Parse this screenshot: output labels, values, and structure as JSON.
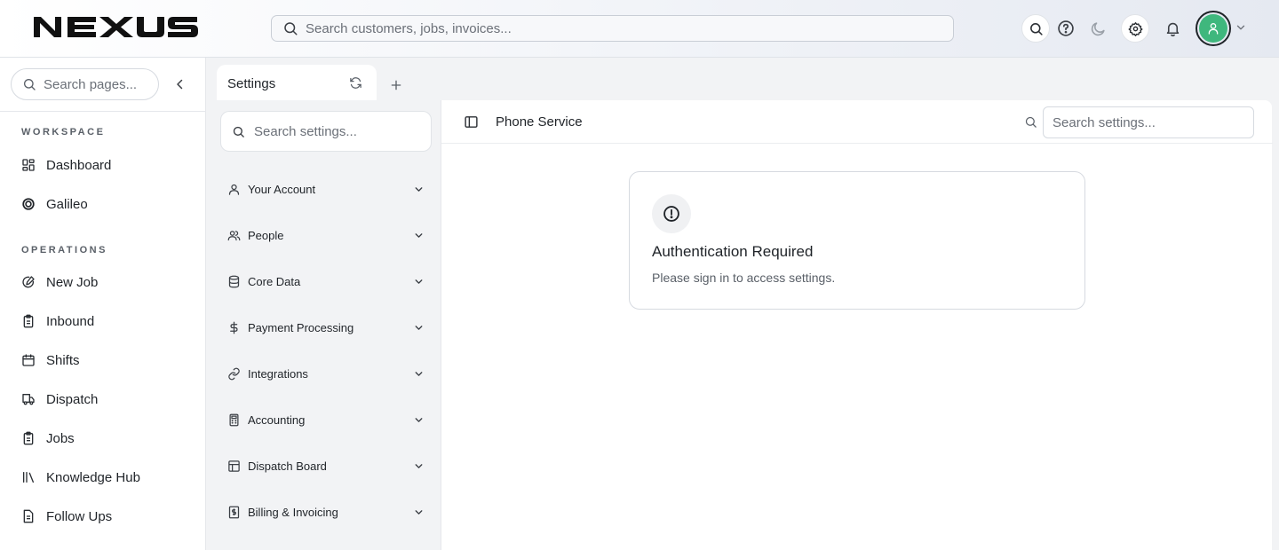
{
  "header": {
    "logo_text": "NEXUS",
    "search_placeholder": "Search customers, jobs, invoices..."
  },
  "sidebar": {
    "search_placeholder": "Search pages...",
    "sections": [
      {
        "label": "WORKSPACE",
        "items": [
          {
            "label": "Dashboard",
            "icon": "dashboard-icon"
          },
          {
            "label": "Galileo",
            "icon": "galileo-icon"
          }
        ]
      },
      {
        "label": "OPERATIONS",
        "items": [
          {
            "label": "New Job",
            "icon": "new-job-icon"
          },
          {
            "label": "Inbound",
            "icon": "clipboard-icon"
          },
          {
            "label": "Shifts",
            "icon": "calendar-icon"
          },
          {
            "label": "Dispatch",
            "icon": "truck-icon"
          },
          {
            "label": "Jobs",
            "icon": "clipboard-icon"
          },
          {
            "label": "Knowledge Hub",
            "icon": "library-icon"
          },
          {
            "label": "Follow Ups",
            "icon": "file-icon"
          }
        ]
      }
    ]
  },
  "tabs": [
    {
      "label": "Settings"
    }
  ],
  "settings_panel": {
    "search_placeholder": "Search settings...",
    "categories": [
      {
        "label": "Your Account",
        "icon": "user-icon"
      },
      {
        "label": "People",
        "icon": "users-icon"
      },
      {
        "label": "Core Data",
        "icon": "database-icon"
      },
      {
        "label": "Payment Processing",
        "icon": "dollar-icon"
      },
      {
        "label": "Integrations",
        "icon": "link-icon"
      },
      {
        "label": "Accounting",
        "icon": "calculator-icon"
      },
      {
        "label": "Dispatch Board",
        "icon": "board-icon"
      },
      {
        "label": "Billing & Invoicing",
        "icon": "receipt-icon"
      }
    ]
  },
  "content": {
    "title": "Phone Service",
    "search_placeholder": "Search settings...",
    "auth_card": {
      "title": "Authentication Required",
      "message": "Please sign in to access settings."
    }
  },
  "colors": {
    "accent_avatar": "#3fb77d",
    "header_gradient_end": "#e5e9f1",
    "workspace_bg": "#f2f3f5"
  }
}
